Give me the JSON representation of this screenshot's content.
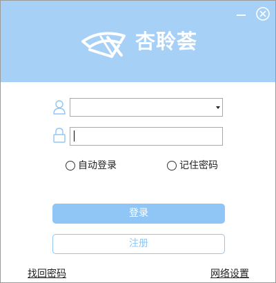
{
  "app": {
    "logo_text": "杏聆荟"
  },
  "login_form": {
    "account_value": "",
    "password_value": "",
    "auto_login_label": "自动登录",
    "remember_password_label": "记住密码",
    "login_button_label": "登录",
    "register_button_label": "注册"
  },
  "footer": {
    "find_password_label": "找回密码",
    "network_settings_label": "网络设置"
  },
  "colors": {
    "header_bg": "#a7d0f7",
    "accent": "#8fc6f6"
  },
  "icons": [
    "minimize-icon",
    "close-icon",
    "user-icon",
    "lock-icon",
    "dropdown-arrow-icon"
  ]
}
